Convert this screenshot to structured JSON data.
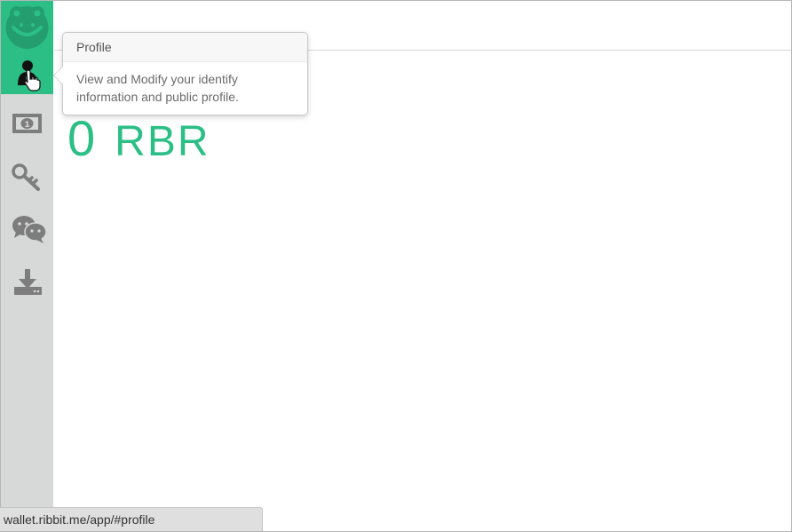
{
  "brand": {
    "logo_icon": "ribbit-frog-logo-icon",
    "accent_color": "#2bbf86"
  },
  "sidebar": {
    "items": [
      {
        "id": "profile",
        "icon": "user-icon",
        "active": true
      },
      {
        "id": "money",
        "icon": "banknote-icon",
        "active": false
      },
      {
        "id": "keys",
        "icon": "key-icon",
        "active": false
      },
      {
        "id": "chat",
        "icon": "chat-icon",
        "active": false
      },
      {
        "id": "download",
        "icon": "download-icon",
        "active": false
      }
    ]
  },
  "popover": {
    "title": "Profile",
    "body": "View and Modify your identify information and public profile."
  },
  "balance": {
    "amount": "0",
    "unit": "RBR"
  },
  "statusbar": {
    "url": "wallet.ribbit.me/app/#profile"
  }
}
